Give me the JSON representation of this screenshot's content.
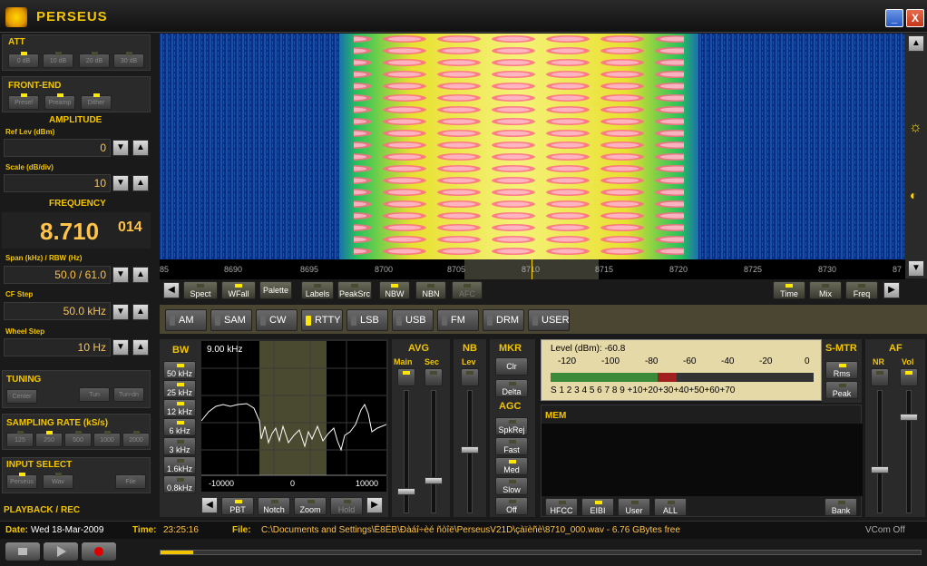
{
  "window": {
    "title": "PERSEUS",
    "minimize": "_",
    "close": "X"
  },
  "att": {
    "title": "ATT",
    "buttons": [
      "0 dB",
      "10 dB",
      "20 dB",
      "30 dB"
    ]
  },
  "frontend": {
    "title": "FRONT-END",
    "buttons": [
      "Presel",
      "Preamp",
      "Dither"
    ]
  },
  "amplitude": {
    "title": "AMPLITUDE",
    "ref_label": "Ref Lev (dBm)",
    "ref_value": "0",
    "scale_label": "Scale (dB/div)",
    "scale_value": "10"
  },
  "frequency": {
    "title": "FREQUENCY",
    "main": "8.710",
    "fine": "014",
    "span_label": "Span (kHz) / RBW (Hz)",
    "span_value": "50.0 / 61.0",
    "cfstep_label": "CF Step",
    "cfstep_value": "50.0 kHz",
    "wheel_label": "Wheel Step",
    "wheel_value": "10 Hz"
  },
  "tuning": {
    "title": "TUNING",
    "buttons": [
      "Center",
      "Tun",
      "Tun-dn"
    ]
  },
  "sampling": {
    "title": "SAMPLING RATE (kS/s)",
    "buttons": [
      "125",
      "250",
      "500",
      "1000",
      "2000"
    ]
  },
  "input": {
    "title": "INPUT SELECT",
    "buttons": [
      "Perseus",
      "Wav",
      "File"
    ]
  },
  "playback": {
    "title": "PLAYBACK / REC"
  },
  "scale": {
    "ticks": [
      "85",
      "8690",
      "8695",
      "8700",
      "8705",
      "8710",
      "8715",
      "8720",
      "8725",
      "8730",
      "87"
    ]
  },
  "toolbar_left": [
    "Spect",
    "WFall",
    "Palette",
    "Labels",
    "PeakSrc",
    "NBW",
    "NBN",
    "AFC"
  ],
  "toolbar_right": [
    "Time",
    "Mix",
    "Freq"
  ],
  "modes": [
    "AM",
    "SAM",
    "CW",
    "RTTY",
    "LSB",
    "USB",
    "FM",
    "DRM",
    "USER"
  ],
  "bw": {
    "title": "BW",
    "options": [
      "50 kHz",
      "25 kHz",
      "12 kHz",
      "6 kHz",
      "3 kHz",
      "1.6kHz",
      "0.8kHz"
    ],
    "display": "9.00 kHz",
    "axis": [
      "-10000",
      "0",
      "10000"
    ],
    "footer": [
      "PBT",
      "Notch",
      "Zoom",
      "Hold"
    ]
  },
  "avg": {
    "title": "AVG",
    "main": "Main",
    "sec": "Sec"
  },
  "nb": {
    "title": "NB",
    "lev": "Lev"
  },
  "mkr": {
    "title": "MKR",
    "clr": "Clr",
    "delta": "Delta"
  },
  "agc": {
    "title": "AGC",
    "buttons": [
      "SpkRej",
      "Fast",
      "Med",
      "Slow",
      "Off"
    ]
  },
  "smeter": {
    "level_text": "Level (dBm): -60.8",
    "dbm_scale": [
      "-120",
      "-100",
      "-80",
      "-60",
      "-40",
      "-20",
      "0"
    ],
    "s_scale": [
      "S",
      "1",
      "2",
      "3",
      "4",
      "5",
      "6",
      "7",
      "8",
      "9",
      "+10",
      "+20",
      "+30",
      "+40",
      "+50",
      "+60",
      "+70"
    ],
    "level_fraction": 0.48,
    "title": "S-MTR",
    "rms": "Rms",
    "peak": "Peak"
  },
  "mem": {
    "title": "MEM",
    "buttons": [
      "HFCC",
      "EIBI",
      "User",
      "ALL"
    ],
    "bank": "Bank"
  },
  "af": {
    "title": "AF",
    "nr": "NR",
    "vol": "Vol"
  },
  "status": {
    "date_label": "Date:",
    "date_value": "Wed 18-Mar-2009",
    "time_label": "Time:",
    "time_value": "23:25:16",
    "file_label": "File:",
    "file_value": "C:\\Documents and Settings\\Ё8ЁВ\\Ðàáî÷èé ñòîë\\PerseusV21D\\çàïèñè\\8710_000.wav - 6.76 GBytes free",
    "vcom": "VCom Off"
  },
  "colors": {
    "accent": "#f3c500",
    "value": "#ffc34a",
    "led_on": "#ffe800"
  }
}
